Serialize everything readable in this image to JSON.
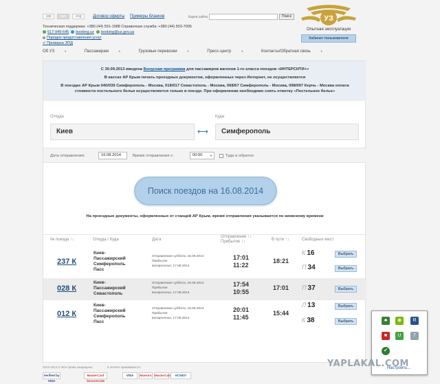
{
  "header": {
    "lang": [
      "укр",
      "рус",
      "eng"
    ],
    "links": [
      "Договор оферты",
      "Примеры бланков"
    ],
    "search_label": "Карта сайта",
    "search_button": "Поиск",
    "support": "Техническая поддержка: +380 (44) 591-1988    Справочная служба: +380 (44) 503-7005",
    "phone": "617-949-645",
    "skype": "booking.uz",
    "email": "booking@uz.gov.ua",
    "link_order": "Порядок предоставления услуг",
    "link_check": "Проверка ЭПД",
    "logo_caption": "Опытная эксплуатация",
    "cabinet": "Кабинет пользователя"
  },
  "nav": [
    "Об УЗ",
    "Пассажирам",
    "Грузовые перевозки",
    "Пресс-центр",
    "Контакты/Обратная связь"
  ],
  "notice": {
    "p1_pre": "С 30.09.2013 введена",
    "p1_link": "Бонусная программа",
    "p1_post": "для пассажиров вагонов 1-го класса поездов «ИНТЕРСИТИ+»",
    "p2": "В кассах АР Крым печать проездных документов, оформленных через Интернет, не осуществляется",
    "p3": "В поездах АР Крым 040/039 Симферополь - Москва, 018/017 Севастополь - Москва, 068/67 Симферополь - Москва, 098/097 Керчь - Москва оплата стоимости постельного белья осуществляется только в поезде. При оформлении необходимо снять отметку «Постельное белье»"
  },
  "form": {
    "from_label": "Откуда",
    "to_label": "Куда",
    "from": "Киев",
    "to": "Симферополь",
    "date_label": "Дата отправления:",
    "date": "16.08.2014",
    "time_label": "Время отправления с:",
    "time": "00:00",
    "round_trip": "Туда и обратно",
    "search_button": "Поиск поездов на 16.08.2014"
  },
  "note2": "На проездные документы, оформленных от станций АР Крым, время отправления указывается по киевскому времени",
  "columns": [
    "№ поезда ↑↓",
    "Откуда / Куда",
    "Дата",
    "Отправление ↑↓",
    "Прибытие ↑↓",
    "В пути ↑↓",
    "Свободных мест"
  ],
  "rows": [
    {
      "no": "237 К",
      "route": [
        "Киев-",
        "Пассажирский",
        "Симферополь",
        "Пасс"
      ],
      "dep_date": "Отправление  суббота, 16.08.2014",
      "arr_date_lbl": "Прибытие",
      "arr_date": "воскресенье, 17.08.2014",
      "dep": "17:01",
      "arr": "11:22",
      "travel": "18:21",
      "seats": [
        {
          "type": "К",
          "n": "16"
        },
        {
          "type": "П",
          "n": "34"
        }
      ]
    },
    {
      "no": "028 К",
      "route": [
        "Киев-",
        "Пассажирский",
        "Севастополь"
      ],
      "dep_date": "Отправление  суббота, 16.08.2014",
      "arr_date_lbl": "Прибытие",
      "arr_date": "воскресенье, 17.08.2014",
      "dep": "17:54",
      "arr": "10:55",
      "travel": "17:01",
      "seats": [
        {
          "type": "П",
          "n": "37"
        }
      ]
    },
    {
      "no": "012 К",
      "route": [
        "Киев-",
        "Пассажирский",
        "Симферополь",
        "Пасс"
      ],
      "dep_date": "Отправление  суббота, 16.08.2014",
      "arr_date_lbl": "Прибытие",
      "arr_date": "воскресенье, 17.08.2014",
      "dep": "20:01",
      "arr": "11:45",
      "travel": "15:44",
      "seats": [
        {
          "type": "Л",
          "n": "13"
        },
        {
          "type": "К",
          "n": "38"
        }
      ]
    }
  ],
  "choose_label": "Выбрать",
  "footer": {
    "copyright": "2012-2014 © Все права защищены",
    "payment_label": "К оплате принимаются:",
    "cards": [
      "Verified by VISA",
      "MasterCard SecureCode",
      "VISA",
      "Maestro",
      "MasterCard",
      "НСМЕП"
    ]
  },
  "tray": {
    "link": "Настроить..."
  },
  "watermark": "YAPLAKAL.COM"
}
